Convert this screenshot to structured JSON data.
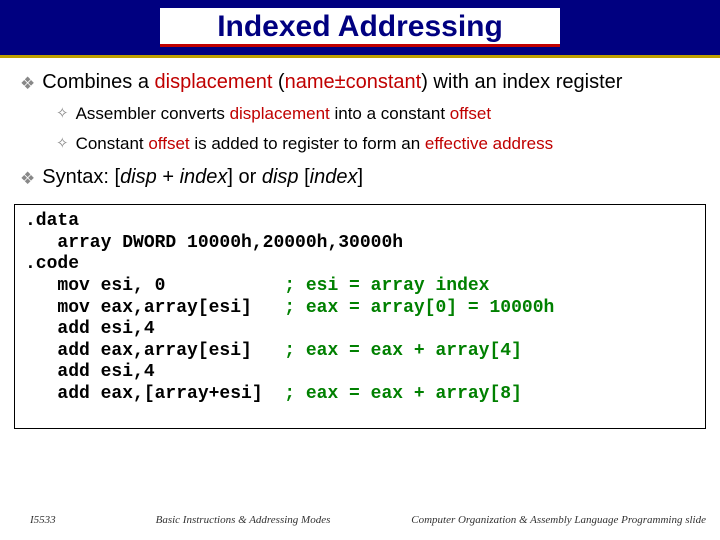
{
  "title": "Indexed Addressing",
  "bullets": {
    "b1": {
      "pre": "Combines a ",
      "disp": "displacement",
      "mid1": " (",
      "nc": "name±constant",
      "mid2": ") with an index register"
    },
    "sub1": {
      "pre": "Assembler converts ",
      "disp": "displacement",
      "mid": " into a constant ",
      "off": "offset"
    },
    "sub2": {
      "pre": "Constant ",
      "off": "offset",
      "mid": " is added to register to form an ",
      "eff": "effective address"
    },
    "b2": "Syntax: [disp + index] or disp [index]"
  },
  "code": {
    "l1": ".data",
    "l2": "   array DWORD 10000h,20000h,30000h",
    "l3": ".code",
    "l4": "   mov esi, 0           ",
    "c4": "; esi = array index",
    "l5": "   mov eax,array[esi]   ",
    "c5": "; eax = array[0] = 10000h",
    "l6": "   add esi,4",
    "l7": "   add eax,array[esi]   ",
    "c7": "; eax = eax + array[4]",
    "l8": "   add esi,4",
    "l9": "   add eax,[array+esi]  ",
    "c9": "; eax = eax + array[8]"
  },
  "footer": {
    "left": "I5533",
    "center": "Basic Instructions & Addressing Modes",
    "right": "Computer Organization & Assembly Language Programming slide"
  }
}
